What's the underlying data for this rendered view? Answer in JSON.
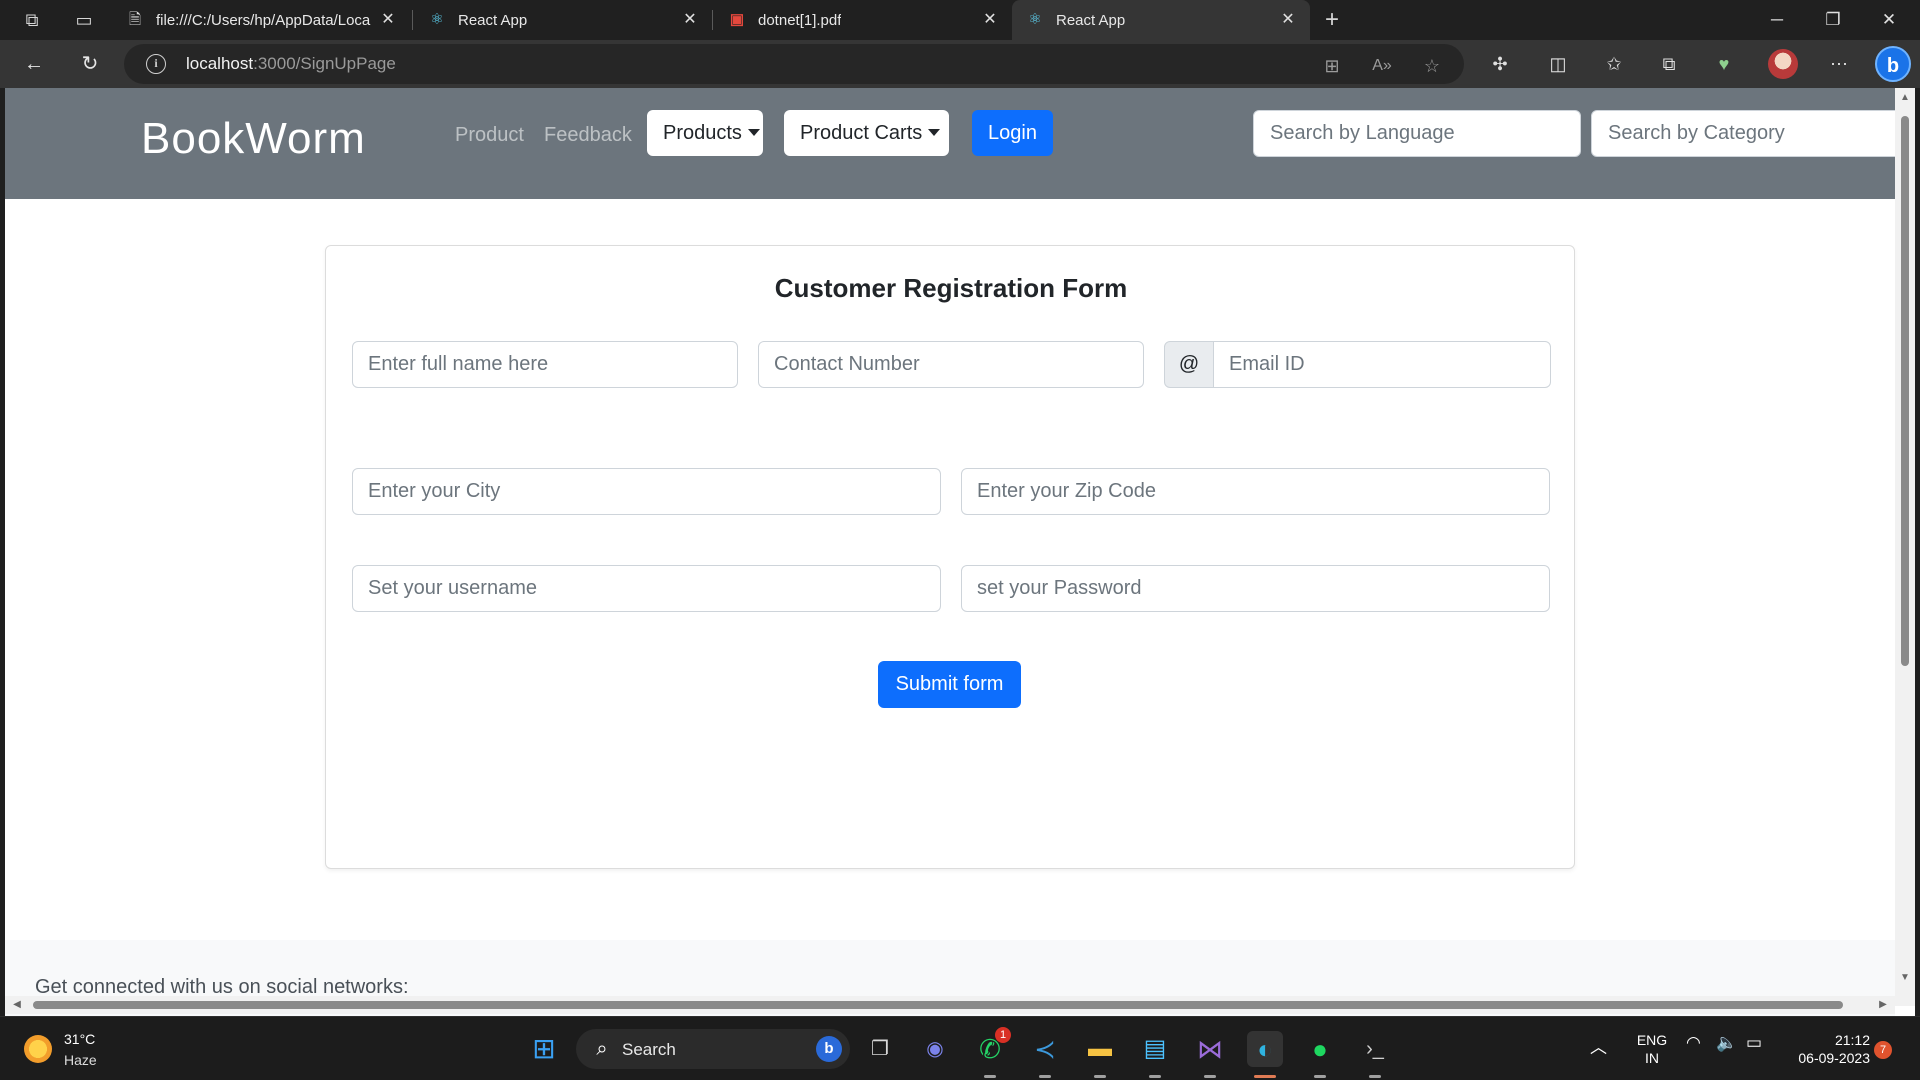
{
  "browser": {
    "tabs": [
      {
        "title": "file:///C:/Users/hp/AppData/Loca",
        "favicon": "pdf-file-icon"
      },
      {
        "title": "React App",
        "favicon": "react-icon"
      },
      {
        "title": "dotnet[1].pdf",
        "favicon": "pdf-icon"
      },
      {
        "title": "React App",
        "favicon": "react-icon",
        "active": true
      }
    ],
    "url_host": "localhost",
    "url_path": ":3000/SignUpPage"
  },
  "navbar": {
    "brand": "BookWorm",
    "links": [
      "Product",
      "Feedback"
    ],
    "products_dropdown": "Products",
    "carts_dropdown": "Product Carts",
    "login": "Login",
    "search_language_placeholder": "Search by Language",
    "search_category_placeholder": "Search by Category",
    "background_color": "#6c757d"
  },
  "form": {
    "title": "Customer Registration Form",
    "fullname_placeholder": "Enter full name here",
    "contact_placeholder": "Contact Number",
    "email_addon": "@",
    "email_placeholder": "Email ID",
    "city_placeholder": "Enter your City",
    "zip_placeholder": "Enter your Zip Code",
    "username_placeholder": "Set your username",
    "password_placeholder": "set your Password",
    "submit": "Submit form",
    "accent_color": "#0d6efd"
  },
  "footer": {
    "text": "Get connected with us on social networks:"
  },
  "taskbar": {
    "weather_temp": "31°C",
    "weather_desc": "Haze",
    "search_label": "Search",
    "whatsapp_badge": "1",
    "lang_line1": "ENG",
    "lang_line2": "IN",
    "time": "21:12",
    "date": "06-09-2023",
    "notification_count": "7"
  }
}
